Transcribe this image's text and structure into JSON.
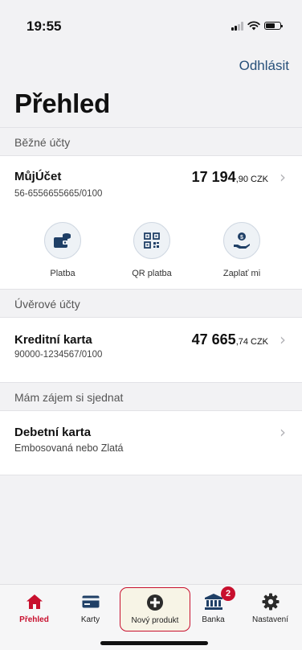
{
  "status_bar": {
    "time": "19:55"
  },
  "header": {
    "logout_label": "Odhlásit",
    "title": "Přehled"
  },
  "sections": {
    "current_accounts": "Běžné účty",
    "credit_accounts": "Úvěrové účty",
    "interest": "Mám zájem si sjednat"
  },
  "account": {
    "name": "MůjÚčet",
    "number": "56-6556655665/0100",
    "amount_int": "17 194",
    "amount_dec": ",90",
    "currency": "CZK"
  },
  "actions": [
    {
      "label": "Platba",
      "icon": "wallet-coins-icon"
    },
    {
      "label": "QR platba",
      "icon": "qr-code-icon"
    },
    {
      "label": "Zaplať mi",
      "icon": "hand-coin-icon"
    }
  ],
  "credit_card": {
    "name": "Kreditní karta",
    "number": "90000-1234567/0100",
    "amount_int": "47 665",
    "amount_dec": ",74",
    "currency": "CZK"
  },
  "offer": {
    "name": "Debetní karta",
    "subtitle": "Embosovaná nebo Zlatá"
  },
  "tabbar": {
    "tabs": [
      {
        "label": "Přehled",
        "icon": "home-icon",
        "active": true
      },
      {
        "label": "Karty",
        "icon": "card-icon"
      },
      {
        "label": "Nový produkt",
        "icon": "plus-circle-icon"
      },
      {
        "label": "Banka",
        "icon": "bank-icon"
      },
      {
        "label": "Nastavení",
        "icon": "gear-icon"
      }
    ],
    "bank_badge": "2"
  },
  "colors": {
    "accent": "#c8102e",
    "link": "#27507a",
    "icon_blue": "#1f3f66"
  }
}
